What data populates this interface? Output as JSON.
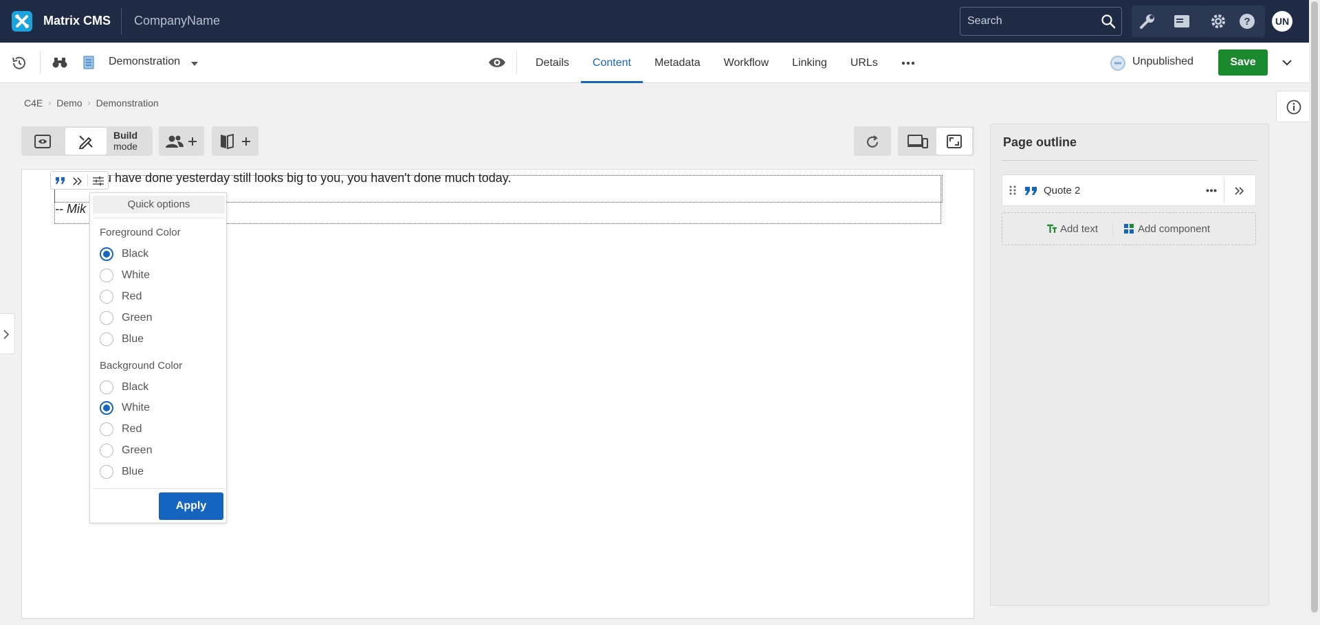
{
  "topbar": {
    "app_title": "Matrix CMS",
    "company": "CompanyName",
    "search_placeholder": "Search",
    "avatar_initials": "UN"
  },
  "subbar": {
    "asset_name": "Demonstration",
    "tabs": [
      {
        "label": "Details",
        "active": false
      },
      {
        "label": "Content",
        "active": true
      },
      {
        "label": "Metadata",
        "active": false
      },
      {
        "label": "Workflow",
        "active": false
      },
      {
        "label": "Linking",
        "active": false
      },
      {
        "label": "URLs",
        "active": false
      }
    ],
    "status": "Unpublished",
    "save_label": "Save"
  },
  "breadcrumb": [
    "C4E",
    "Demo",
    "Demonstration"
  ],
  "editor": {
    "build_label_line1": "Build",
    "build_label_line2": "mode",
    "quote_text": "ou have done yesterday still looks big to you, you haven't done much today.",
    "quote_author": "-- Mik"
  },
  "quick_options": {
    "title": "Quick options",
    "foreground_label": "Foreground Color",
    "foreground_options": [
      "Black",
      "White",
      "Red",
      "Green",
      "Blue"
    ],
    "foreground_selected": "Black",
    "background_label": "Background Color",
    "background_options": [
      "Black",
      "White",
      "Red",
      "Green",
      "Blue"
    ],
    "background_selected": "White",
    "apply_label": "Apply"
  },
  "outline": {
    "title": "Page outline",
    "item_label": "Quote 2",
    "add_text_label": "Add text",
    "add_component_label": "Add component"
  },
  "colors": {
    "topbar_bg": "#1f2b45",
    "accent": "#1565c0",
    "save_green": "#1b8a2e",
    "add_green": "#1b8a2e"
  }
}
